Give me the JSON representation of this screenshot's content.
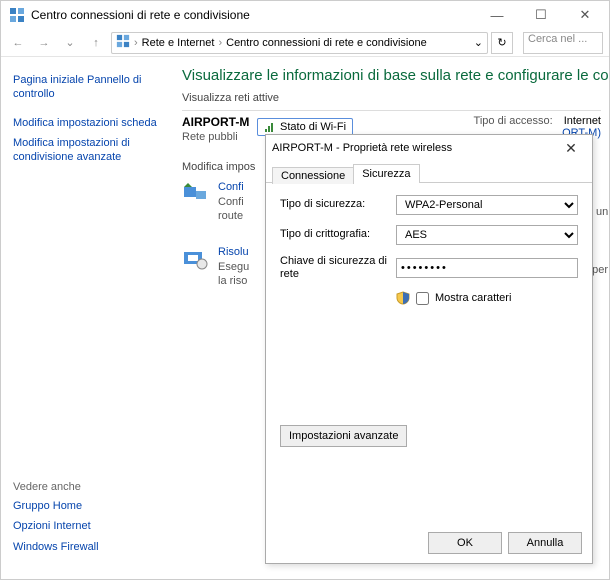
{
  "window": {
    "title": "Centro connessioni di rete e condivisione",
    "min_icon": "—",
    "max_icon": "☐",
    "close_icon": "✕"
  },
  "nav": {
    "back": "←",
    "forward": "→",
    "up": "↑",
    "crumb1": "Rete e Internet",
    "crumb2": "Centro connessioni di rete e condivisione",
    "sep": "›",
    "dropdown": "⌄",
    "refresh": "↻",
    "search_placeholder": "Cerca nel ..."
  },
  "sidebar": {
    "home": "Pagina iniziale Pannello di controllo",
    "change_adapter": "Modifica impostazioni scheda",
    "change_sharing": "Modifica impostazioni di condivisione avanzate",
    "see_also_hdr": "Vedere anche",
    "homegroup": "Gruppo Home",
    "inet_opts": "Opzioni Internet",
    "firewall": "Windows Firewall"
  },
  "content": {
    "heading": "Visualizzare le informazioni di base sulla rete e configurare le connessioni",
    "active_hdr": "Visualizza reti attive",
    "net_name": "AIRPORT-M",
    "net_type": "Rete pubbli",
    "access_lbl": "Tipo di accesso:",
    "access_val": "Internet",
    "conn_link": "ORT-M)",
    "edit_hdr": "Modifica impos",
    "conf_title": "Confi",
    "conf_desc1": "Confi",
    "conf_desc2": "route",
    "trouble_title": "Risolu",
    "trouble_desc1": "Esegu",
    "trouble_desc2": "la riso",
    "un": "un",
    "ioni_per": "ioni per"
  },
  "backpop": {
    "text": "Stato di Wi-Fi"
  },
  "dialog": {
    "title": "AIRPORT-M - Proprietà rete wireless",
    "close": "✕",
    "tab_connection": "Connessione",
    "tab_security": "Sicurezza",
    "sec_type_lbl": "Tipo di sicurezza:",
    "sec_type_val": "WPA2-Personal",
    "enc_lbl": "Tipo di crittografia:",
    "enc_val": "AES",
    "key_lbl": "Chiave di sicurezza di rete",
    "key_val": "••••••••",
    "show_chars": "Mostra caratteri",
    "advanced": "Impostazioni avanzate",
    "ok": "OK",
    "cancel": "Annulla"
  }
}
